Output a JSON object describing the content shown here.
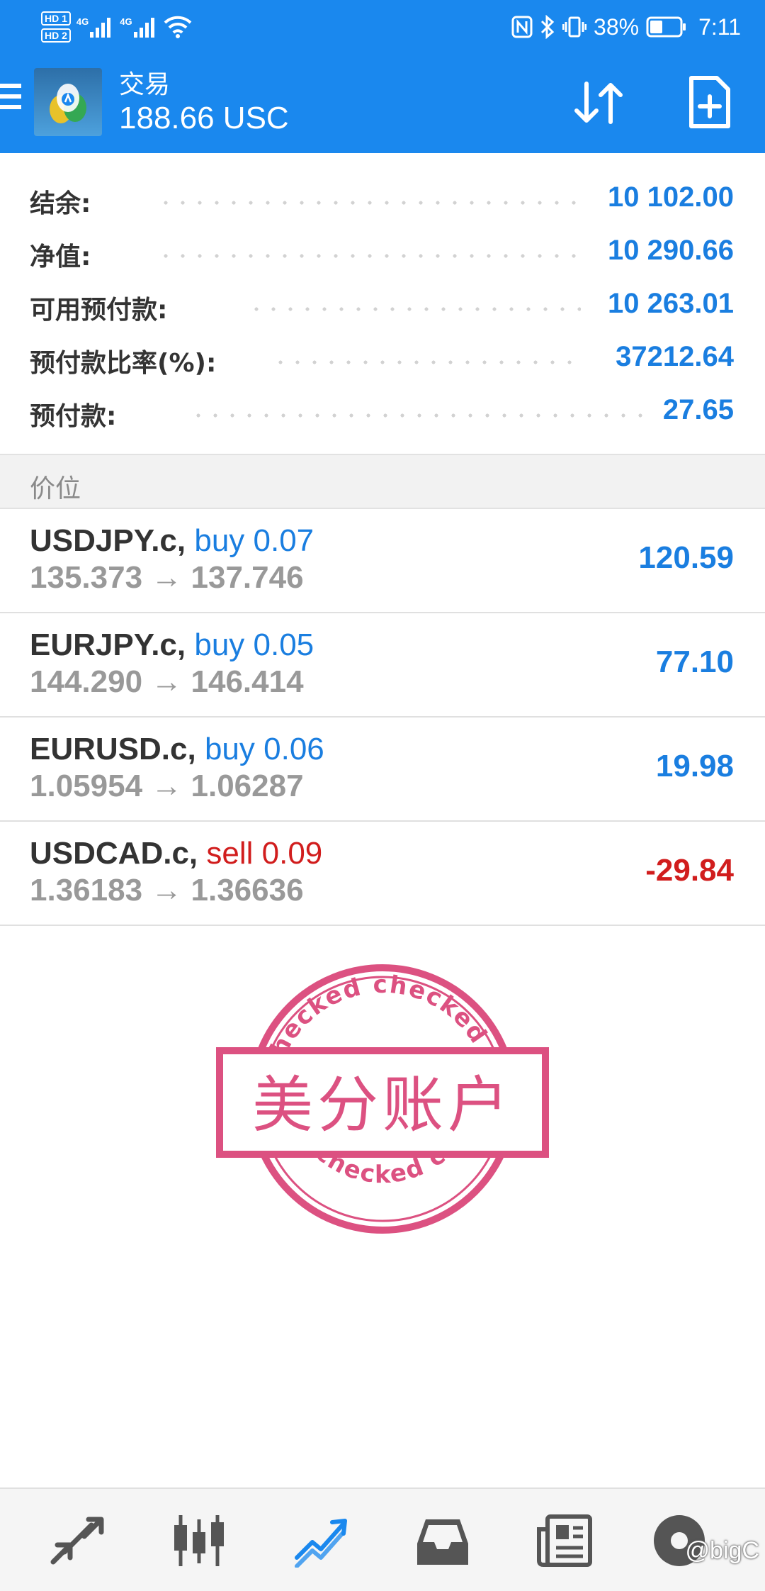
{
  "status_bar": {
    "hd1": "HD 1",
    "hd2": "HD 2",
    "net1": "4G",
    "net2": "4G",
    "icons": [
      "nfc-icon",
      "bluetooth-icon",
      "vibrate-icon"
    ],
    "battery": "38%",
    "time": "7:11"
  },
  "header": {
    "title": "交易",
    "subtitle": "188.66 USC",
    "menu_icon": "hamburger-menu-icon",
    "sort_icon": "sort-arrows-icon",
    "new_order_icon": "new-order-document-icon"
  },
  "summary": [
    {
      "label": "结余:",
      "value": "10 102.00"
    },
    {
      "label": "净值:",
      "value": "10 290.66"
    },
    {
      "label": "可用预付款:",
      "value": "10 263.01"
    },
    {
      "label": "预付款比率(%):",
      "value": "37212.64"
    },
    {
      "label": "预付款:",
      "value": "27.65"
    }
  ],
  "section_title": "价位",
  "positions": [
    {
      "symbol": "USDJPY.c,",
      "type": "buy 0.07",
      "side": "buy",
      "prices": "135.373 → 137.746",
      "profit": "120.59"
    },
    {
      "symbol": "EURJPY.c,",
      "type": "buy 0.05",
      "side": "buy",
      "prices": "144.290 → 146.414",
      "profit": "77.10"
    },
    {
      "symbol": "EURUSD.c,",
      "type": "buy 0.06",
      "side": "buy",
      "prices": "1.05954 → 1.06287",
      "profit": "19.98"
    },
    {
      "symbol": "USDCAD.c,",
      "type": "sell 0.09",
      "side": "sell",
      "prices": "1.36183 → 1.36636",
      "profit": "-29.84"
    }
  ],
  "stamp": {
    "text": "美分账户",
    "ring_text": "checked"
  },
  "bottom_nav": [
    {
      "icon": "quotes-arrows-icon",
      "active": false
    },
    {
      "icon": "chart-candlestick-icon",
      "active": false
    },
    {
      "icon": "trade-trend-icon",
      "active": true
    },
    {
      "icon": "inbox-icon",
      "active": false
    },
    {
      "icon": "news-icon",
      "active": false
    },
    {
      "icon": "settings-avatar-icon",
      "active": false
    }
  ],
  "watermark": "@bigC",
  "colors": {
    "brand_blue": "#1a88ee",
    "value_blue": "#1a7ee0",
    "sell_red": "#d11d1d",
    "stamp_pink": "#d6336c"
  }
}
